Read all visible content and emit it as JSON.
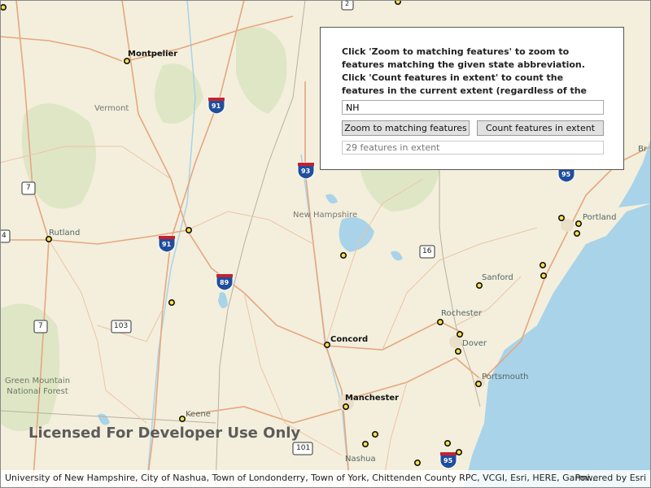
{
  "map": {
    "cities": {
      "montpelier": "Montpelier",
      "rutland": "Rutland",
      "concord": "Concord",
      "manchester": "Manchester",
      "nashua": "Nashua",
      "keene": "Keene",
      "portland": "Portland",
      "sanford": "Sanford",
      "rochester": "Rochester",
      "dover": "Dover",
      "portsmouth": "Portsmouth",
      "brunswick_partial": "Br"
    },
    "regions": {
      "vermont": "Vermont",
      "new_hampshire": "New Hampshire",
      "green_mountain": "Green Mountain\nNational Forest"
    },
    "shields": {
      "i91": "91",
      "i91b": "91",
      "i93": "93",
      "i89": "89",
      "i95": "95",
      "i95b": "95",
      "us7": "7",
      "us7b": "7",
      "us4": "4",
      "us16": "16",
      "us103": "103",
      "us101": "101",
      "us2": "2"
    },
    "watermark": "Licensed For Developer Use Only"
  },
  "panel": {
    "instructions": "Click 'Zoom to matching features' to zoom to features matching the given state abbreviation. Click 'Count features in extent' to count the features in the current extent (regardless of the results of the query).",
    "state_value": "NH",
    "zoom_label": "Zoom to matching features",
    "count_label": "Count features in extent",
    "result_text": "29 features in extent"
  },
  "attribution": {
    "text": "University of New Hampshire, City of Nashua, Town of Londonderry, Town of York, Chittenden County RPC, VCGI, Esri, HERE, Garmi...",
    "powered": "Powered by Esri"
  },
  "colors": {
    "land": "#f3efdc",
    "forest": "#d8e2bf",
    "water": "#a9d3e8",
    "road_major": "#e5a27f",
    "road_minor": "#eeb99a",
    "feature_fill": "#f6e24a"
  }
}
